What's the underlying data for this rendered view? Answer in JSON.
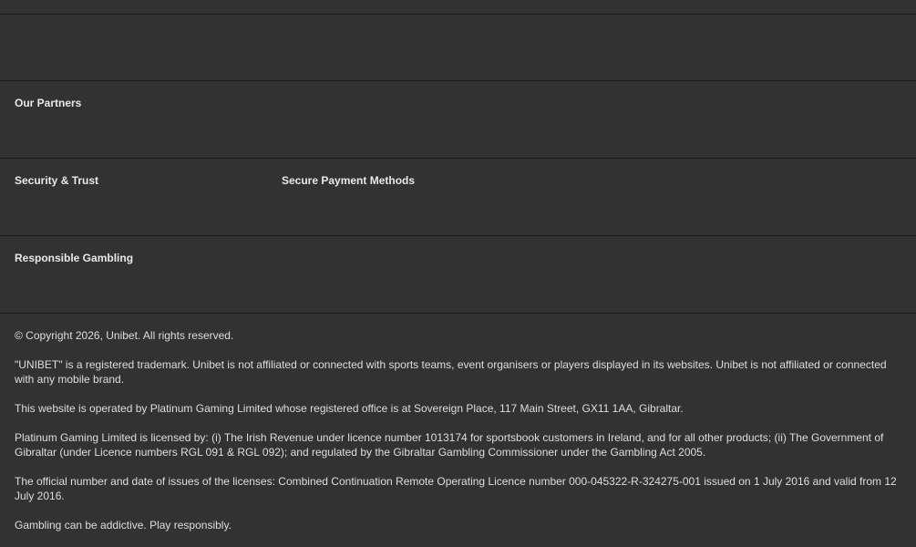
{
  "sections": {
    "partners_heading": "Our Partners",
    "security_heading": "Security & Trust",
    "payment_heading": "Secure Payment Methods",
    "responsible_heading": "Responsible Gambling"
  },
  "legal": {
    "copyright": "© Copyright 2026, Unibet. All rights reserved.",
    "trademark": "\"UNIBET\" is a registered trademark. Unibet is not affiliated or connected with sports teams, event organisers or players displayed in its websites. Unibet is not affiliated or connected with any mobile brand.",
    "operator": "This website is operated by Platinum Gaming Limited whose registered office is at Sovereign Place, 117 Main Street, GX11 1AA, Gibraltar.",
    "license": "Platinum Gaming Limited is licensed by: (i) The Irish Revenue under licence number 1013174 for sportsbook customers in Ireland, and for all other products; (ii) The Government of Gibraltar (under Licence numbers RGL 091 & RGL 092); and regulated by the Gibraltar Gambling Commissioner under the Gambling Act 2005.",
    "license_details": "The official number and date of issues of the licenses: Combined Continuation Remote Operating Licence number 000-045322-R-324275-001 issued on 1 July 2016 and valid from 12 July 2016.",
    "warning": "Gambling can be addictive. Play responsibly."
  },
  "colors": {
    "background": "#323232",
    "divider": "#1b1b1b",
    "text": "#e6e6e6"
  }
}
